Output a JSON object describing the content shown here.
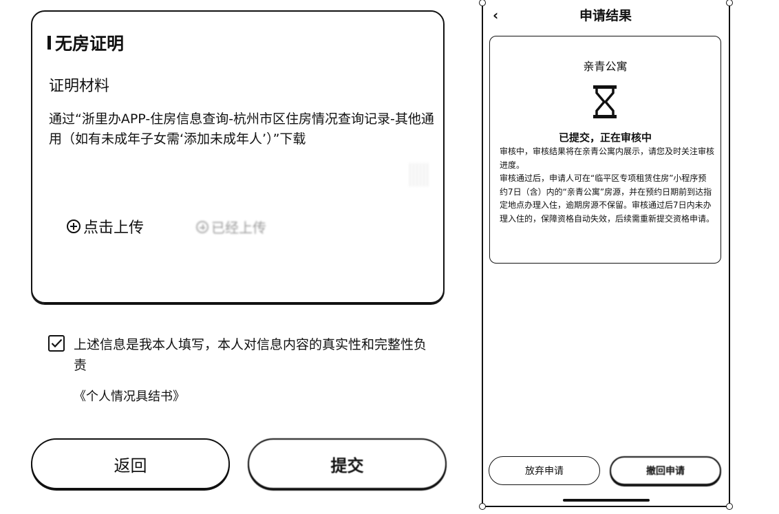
{
  "form": {
    "title": "无房证明",
    "material_label": "证明材料",
    "description": "通过“浙里办APP-住房信息查询-杭州市区住房情况查询记录-其他通用（如有未成年子女需‘添加未成年人’）”下载",
    "upload_label": "点击上传",
    "uploaded_label": "已经上传",
    "agreement_checked": true,
    "agreement_text": "上述信息是我本人填写，本人对信息内容的真实性和完整性负责",
    "declaration_link": "《个人情况具结书》",
    "back_button": "返回",
    "submit_button": "提交"
  },
  "phone": {
    "back_icon": "chevron-left-icon",
    "title": "申请结果",
    "apartment_name": "亲青公寓",
    "status_icon": "hourglass-icon",
    "status_text": "已提交，正在审核中",
    "note_1": "审核中，审核结果将在亲青公寓内展示，请您及时关注审核进度。",
    "note_2": "审核通过后，申请人可在“临平区专项租赁住房”小程序预约7日（含）内的“亲青公寓”房源，并在预约日期前到达指定地点办理入住，逾期房源不保留。审核通过后7日内未办理入住的，保障资格自动失效，后续需重新提交资格申请。",
    "abandon_button": "放弃申请",
    "withdraw_button": "撤回申请"
  }
}
